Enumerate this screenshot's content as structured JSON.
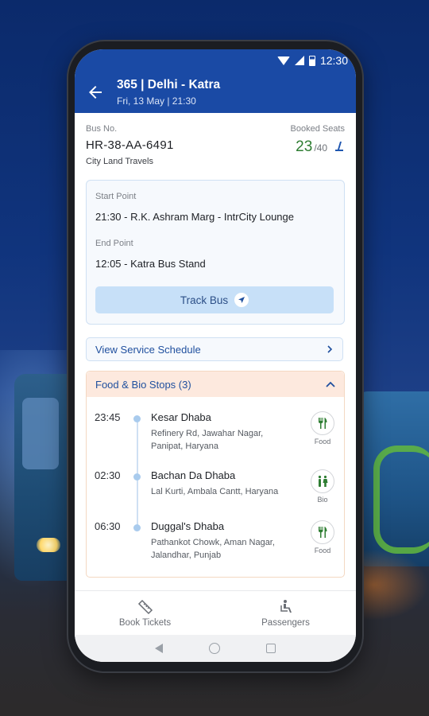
{
  "status_bar": {
    "time": "12:30"
  },
  "header": {
    "title": "365 | Delhi - Katra",
    "subtitle": "Fri, 13 May  |  21:30"
  },
  "bus": {
    "no_label": "Bus No.",
    "no": "HR-38-AA-6491",
    "operator": "City Land Travels",
    "booked_label": "Booked Seats",
    "booked": "23",
    "total": "/40"
  },
  "route": {
    "start_label": "Start Point",
    "start_value": "21:30 - R.K. Ashram Marg - IntrCity Lounge",
    "end_label": "End Point",
    "end_value": "12:05 - Katra Bus Stand",
    "track_label": "Track Bus"
  },
  "schedule_label": "View Service Schedule",
  "stops": {
    "header": "Food & Bio Stops (3)",
    "items": [
      {
        "time": "23:45",
        "name": "Kesar Dhaba",
        "address": "Refinery Rd, Jawahar Nagar, Panipat, Haryana",
        "type": "Food",
        "icon": "food-icon"
      },
      {
        "time": "02:30",
        "name": "Bachan Da Dhaba",
        "address": "Lal Kurti, Ambala Cantt, Haryana",
        "type": "Bio",
        "icon": "restroom-icon"
      },
      {
        "time": "06:30",
        "name": "Duggal's Dhaba",
        "address": "Pathankot Chowk, Aman Nagar, Jalandhar, Punjab",
        "type": "Food",
        "icon": "food-icon"
      }
    ]
  },
  "bottom_nav": {
    "book": "Book Tickets",
    "passengers": "Passengers"
  },
  "colors": {
    "primary": "#1a4aa5",
    "seats_green": "#2e7d32",
    "stops_header_bg": "#fde9de",
    "track_button_bg": "#c7e0f8"
  }
}
